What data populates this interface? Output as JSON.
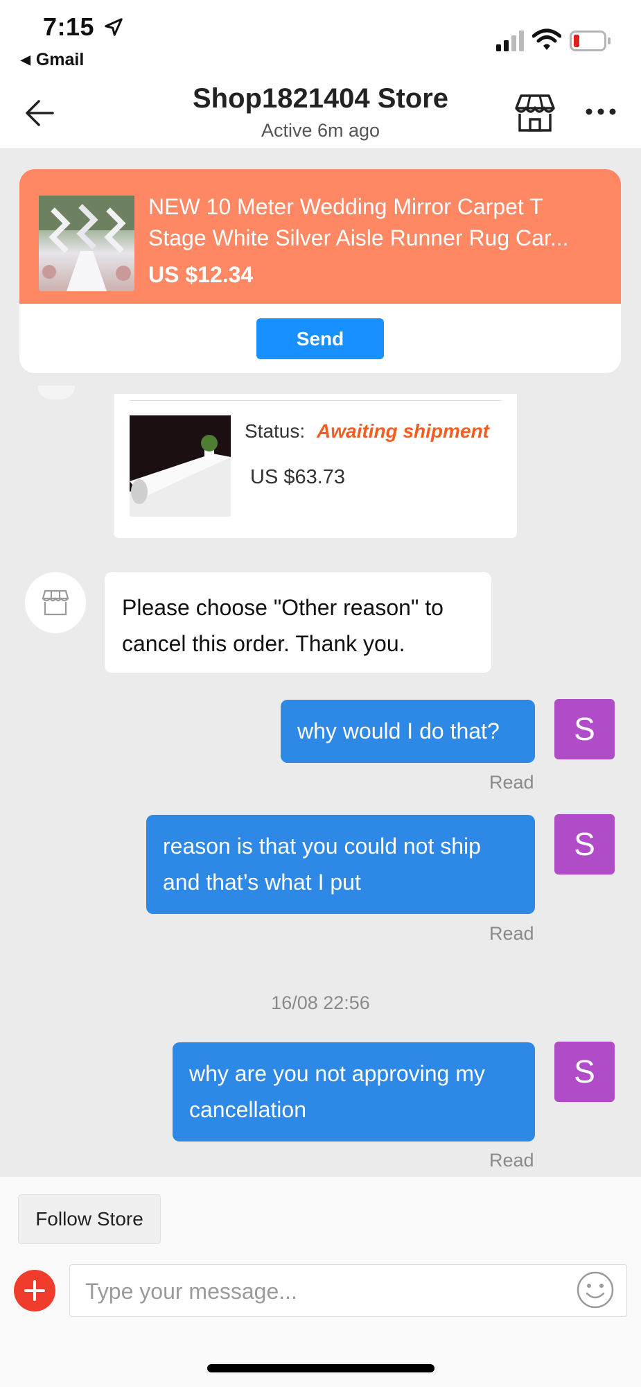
{
  "status_bar": {
    "time": "7:15",
    "back_app": "Gmail",
    "battery_color": "#e02020"
  },
  "header": {
    "title": "Shop1821404 Store",
    "subtitle": "Active 6m ago"
  },
  "product": {
    "title": "NEW 10 Meter Wedding Mirror Carpet T Stage White Silver Aisle Runner Rug Car...",
    "price": "US $12.34",
    "send_label": "Send"
  },
  "order": {
    "status_label": "Status:",
    "status_value": "Awaiting shipment",
    "amount": "US $63.73"
  },
  "messages": [
    {
      "from": "store",
      "text": "Please choose \"Other reason\" to cancel this order. Thank you."
    },
    {
      "from": "user",
      "text": "why would I do that?",
      "avatar": "S",
      "read": "Read"
    },
    {
      "from": "user",
      "text": "reason is that you could not ship and that’s what I put",
      "avatar": "S",
      "read": "Read"
    },
    {
      "timestamp": "16/08 22:56"
    },
    {
      "from": "user",
      "text": "why are you not approving my cancellation",
      "avatar": "S",
      "read": "Read"
    }
  ],
  "bottom_bar": {
    "follow_label": "Follow Store",
    "input_placeholder": "Type your message...",
    "input_value": ""
  },
  "colors": {
    "accent_blue": "#1890ff",
    "bubble_blue": "#2e88e6",
    "banner_orange": "#fe8764",
    "status_orange": "#f45d22",
    "avatar_purple": "#b04cc7",
    "plus_red": "#f03c2c"
  }
}
